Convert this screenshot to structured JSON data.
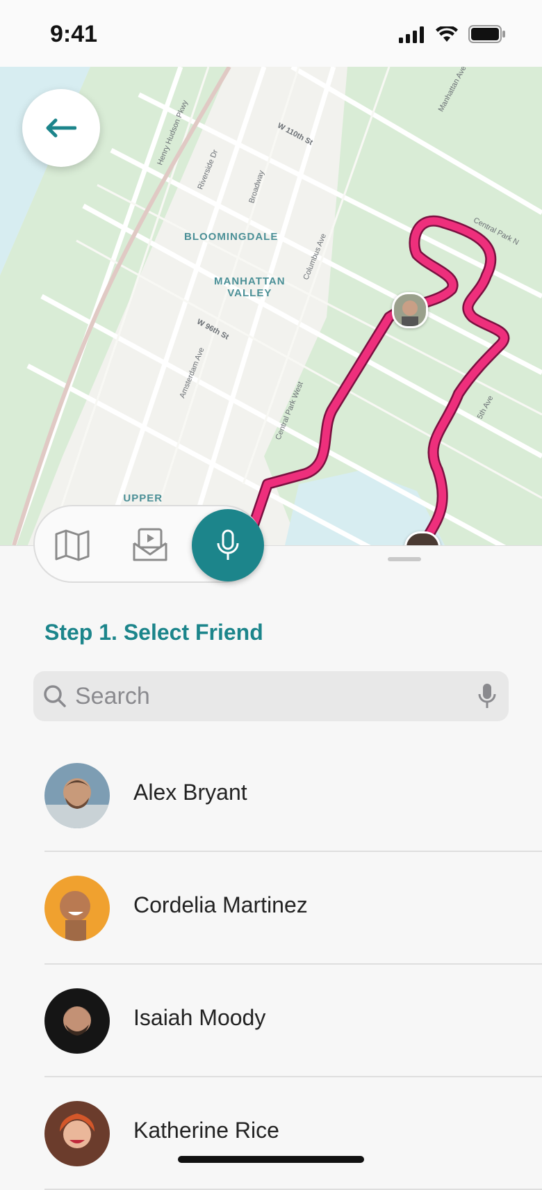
{
  "status_bar": {
    "time": "9:41"
  },
  "map": {
    "neighborhoods": [
      "BLOOMINGDALE",
      "MANHATTAN\nVALLEY",
      "UPPER\nWEST SIDE"
    ],
    "streets": {
      "henry_hudson": "Henry Hudson Pkwy",
      "riverside_dr": "Riverside Dr",
      "broadway": "Broadway",
      "w_110": "W 110th St",
      "w_96": "W 96th St",
      "columbus": "Columbus Ave",
      "cpw": "Central Park West",
      "amsterdam": "Amsterdam Ave",
      "fifth": "5th Ave",
      "cpn": "Central Park N",
      "manhattan_ave": "Manhattan Ave"
    },
    "route_color": "#ee2f7c"
  },
  "mode_bar": {
    "map_icon": "map-icon",
    "media_icon": "media-envelope-icon",
    "mic_icon": "microphone-icon"
  },
  "sheet": {
    "step_title": "Step 1. Select Friend",
    "search": {
      "placeholder": "Search"
    },
    "friends": [
      {
        "name": "Alex Bryant"
      },
      {
        "name": "Cordelia Martinez"
      },
      {
        "name": "Isaiah Moody"
      },
      {
        "name": "Katherine Rice"
      }
    ]
  },
  "colors": {
    "accent": "#1c858b",
    "route": "#ee2f7c",
    "park": "#d9ecd6",
    "water": "#d7edf1"
  }
}
